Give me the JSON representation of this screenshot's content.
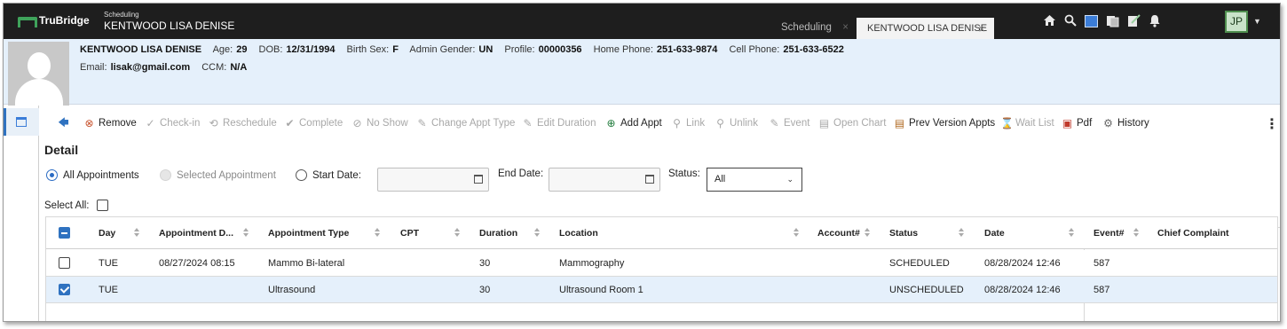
{
  "topbar": {
    "brand": "TruBridge",
    "context_small": "Scheduling",
    "context_patient": "KENTWOOD LISA DENISE",
    "tabs": [
      {
        "label": "Scheduling",
        "close": "×"
      },
      {
        "label": "KENTWOOD LISA DENISE",
        "close": "×"
      }
    ],
    "icons": [
      "home-icon",
      "search-icon",
      "calendar-icon",
      "document-icon",
      "note-icon",
      "apps-grid-icon",
      "bell-icon"
    ],
    "user_initials": "JP"
  },
  "patient": {
    "name": "KENTWOOD LISA DENISE",
    "age_label": "Age:",
    "age": "29",
    "dob_label": "DOB:",
    "dob": "12/31/1994",
    "birth_sex_label": "Birth Sex:",
    "birth_sex": "F",
    "admin_gender_label": "Admin Gender:",
    "admin_gender": "UN",
    "profile_label": "Profile:",
    "profile": "00000356",
    "home_phone_label": "Home Phone:",
    "home_phone": "251-633-9874",
    "cell_phone_label": "Cell Phone:",
    "cell_phone": "251-633-6522",
    "email_label": "Email:",
    "email": "lisak@gmail.com",
    "ccm_label": "CCM:",
    "ccm": "N/A"
  },
  "toolbar": {
    "items": [
      {
        "label": "",
        "icon": "back-arrow-icon",
        "enabled": true
      },
      {
        "label": "Remove",
        "icon": "remove-icon",
        "enabled": true
      },
      {
        "label": "Check-in",
        "icon": "check-icon",
        "enabled": false
      },
      {
        "label": "Reschedule",
        "icon": "reschedule-icon",
        "enabled": false
      },
      {
        "label": "Complete",
        "icon": "complete-icon",
        "enabled": false
      },
      {
        "label": "No Show",
        "icon": "no-show-icon",
        "enabled": false
      },
      {
        "label": "Change Appt Type",
        "icon": "edit-icon",
        "enabled": false
      },
      {
        "label": "Edit Duration",
        "icon": "edit-icon",
        "enabled": false
      },
      {
        "label": "Add Appt",
        "icon": "plus-icon",
        "enabled": true
      },
      {
        "label": "Link",
        "icon": "link-icon",
        "enabled": false
      },
      {
        "label": "Unlink",
        "icon": "unlink-icon",
        "enabled": false
      },
      {
        "label": "Event",
        "icon": "event-icon",
        "enabled": false
      },
      {
        "label": "Open Chart",
        "icon": "chart-icon",
        "enabled": false
      },
      {
        "label": "Prev Version Appts",
        "icon": "prev-version-icon",
        "enabled": true
      },
      {
        "label": "Wait List",
        "icon": "wait-list-icon",
        "enabled": false
      },
      {
        "label": "Pdf",
        "icon": "pdf-icon",
        "enabled": true
      },
      {
        "label": "History",
        "icon": "history-icon",
        "enabled": true
      }
    ],
    "more": "⋮"
  },
  "detail": {
    "title": "Detail",
    "filters": {
      "all_appointments": "All Appointments",
      "selected_appointment": "Selected Appointment",
      "start_date": "Start Date:",
      "end_date": "End Date:",
      "status_label": "Status:",
      "status_value": "All",
      "start_date_value": "",
      "end_date_value": ""
    },
    "select_all": "Select All:"
  },
  "table": {
    "columns": [
      "Day",
      "Appointment D...",
      "Appointment Type",
      "CPT",
      "Duration",
      "Location",
      "Account#",
      "Status",
      "Date",
      "Event#",
      "Chief Complaint"
    ],
    "rows": [
      {
        "checked": false,
        "day": "TUE",
        "appt_date": "08/27/2024 08:15",
        "type": "Mammo Bi-lateral",
        "cpt": "",
        "duration": "30",
        "location": "Mammography",
        "account": "",
        "status": "SCHEDULED",
        "date": "08/28/2024 12:46",
        "event": "587",
        "complaint": ""
      },
      {
        "checked": true,
        "day": "TUE",
        "appt_date": "",
        "type": "Ultrasound",
        "cpt": "",
        "duration": "30",
        "location": "Ultrasound Room 1",
        "account": "",
        "status": "UNSCHEDULED",
        "date": "08/28/2024 12:46",
        "event": "587",
        "complaint": ""
      }
    ]
  },
  "colors": {
    "accent": "#2f72c0",
    "topbar_bg": "#1e1e1e",
    "header_bg": "#e5f0fb",
    "brand_green": "#3fa35b"
  }
}
